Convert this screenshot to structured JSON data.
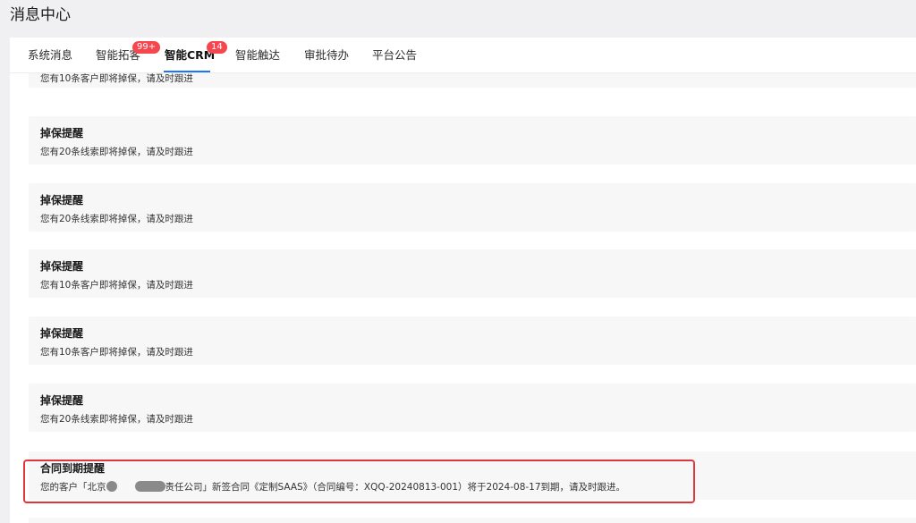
{
  "page": {
    "title": "消息中心"
  },
  "tabs": [
    {
      "label": "系统消息",
      "badge": ""
    },
    {
      "label": "智能拓客",
      "badge": "99+"
    },
    {
      "label": "智能CRM",
      "badge": "14"
    },
    {
      "label": "智能触达",
      "badge": ""
    },
    {
      "label": "审批待办",
      "badge": ""
    },
    {
      "label": "平台公告",
      "badge": ""
    }
  ],
  "active_tab": "智能CRM",
  "messages": [
    {
      "title": "",
      "desc": "您有10条客户即将掉保，请及时跟进"
    },
    {
      "title": "掉保提醒",
      "desc": "您有20条线索即将掉保，请及时跟进"
    },
    {
      "title": "掉保提醒",
      "desc": "您有20条线索即将掉保，请及时跟进"
    },
    {
      "title": "掉保提醒",
      "desc": "您有10条客户即将掉保，请及时跟进"
    },
    {
      "title": "掉保提醒",
      "desc": "您有10条客户即将掉保，请及时跟进"
    },
    {
      "title": "掉保提醒",
      "desc": "您有20条线索即将掉保，请及时跟进"
    },
    {
      "title": "合同到期提醒",
      "desc_prefix": "您的客户「北京",
      "desc_suffix": "责任公司」新签合同《定制SAAS》（合同编号：XQQ-20240813-001）将于2024-08-17到期，请及时跟进。"
    }
  ],
  "colors": {
    "accent": "#1677ff",
    "badge": "#f5474d",
    "highlight": "#e0353b",
    "card_bg": "#f7f7f8"
  }
}
